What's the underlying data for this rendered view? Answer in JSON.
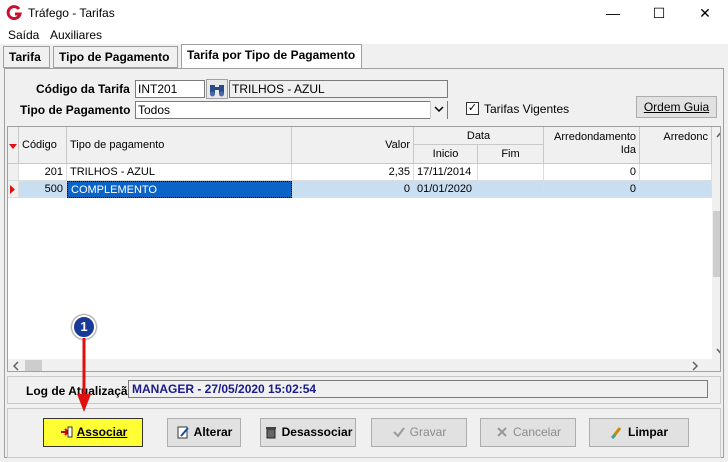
{
  "window": {
    "title": "Tráfego - Tarifas"
  },
  "menu": [
    "Saída",
    "Auxiliares"
  ],
  "tabs": [
    "Tarifa",
    "Tipo de Pagamento",
    "Tarifa por Tipo de Pagamento"
  ],
  "form": {
    "codigo_label": "Código da Tarifa",
    "codigo_value": "INT201",
    "codigo_desc": "TRILHOS - AZUL",
    "tipo_label": "Tipo de Pagamento",
    "tipo_value": "Todos",
    "vigentes_label": "Tarifas Vigentes",
    "vigentes_checked": "✓",
    "ordem_button": "Ordem Guia"
  },
  "grid": {
    "headers": {
      "codigo": "Código",
      "tipo": "Tipo de pagamento",
      "valor": "Valor",
      "data": "Data",
      "inicio": "Inicio",
      "fim": "Fim",
      "arred_ida": "Arredondamento Ida",
      "arred_volta": "Arredonc"
    },
    "rows": [
      {
        "codigo": "201",
        "tipo": "TRILHOS - AZUL",
        "valor": "2,35",
        "inicio": "17/11/2014",
        "fim": "",
        "arred": "0"
      },
      {
        "codigo": "500",
        "tipo": "COMPLEMENTO",
        "valor": "0",
        "inicio": "01/01/2020",
        "fim": "",
        "arred": "0"
      }
    ]
  },
  "log": {
    "label": "Log de Atualização",
    "value": "MANAGER - 27/05/2020 15:02:54"
  },
  "buttons": {
    "associar": "Associar",
    "alterar": "Alterar",
    "desassociar": "Desassociar",
    "gravar": "Gravar",
    "cancelar": "Cancelar",
    "limpar": "Limpar"
  },
  "annotation": {
    "step": "1"
  },
  "colors": {
    "selected_row": "#c9def1",
    "primary_button": "#ffff33",
    "arrow": "#e01010",
    "log_text": "#1a1a8c"
  }
}
